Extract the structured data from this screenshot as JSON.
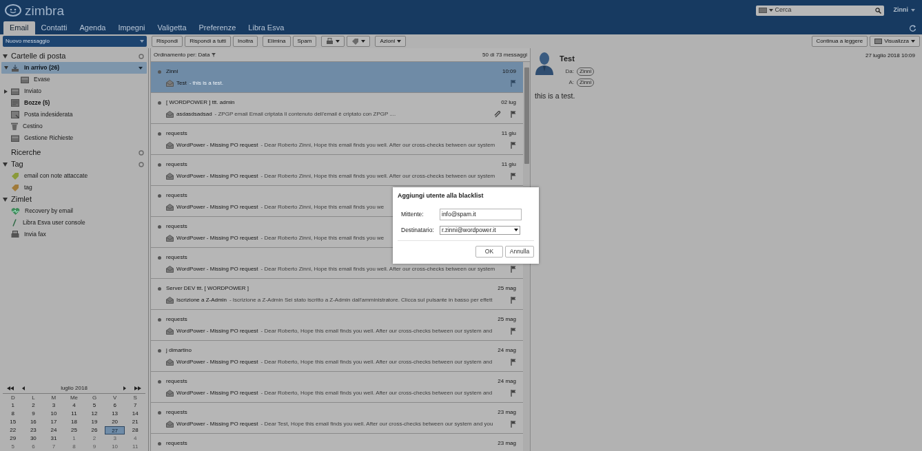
{
  "header": {
    "logo": "zimbra",
    "search": {
      "placeholder": "Cerca"
    },
    "user": "Zinni"
  },
  "tabs": [
    {
      "label": "Email",
      "selected": true
    },
    {
      "label": "Contatti",
      "selected": false
    },
    {
      "label": "Agenda",
      "selected": false
    },
    {
      "label": "Impegni",
      "selected": false
    },
    {
      "label": "Valigetta",
      "selected": false
    },
    {
      "label": "Preferenze",
      "selected": false
    },
    {
      "label": "Libra Esva",
      "selected": false
    }
  ],
  "new_button": "Nuovo messaggio",
  "toolbar": [
    {
      "kind": "text",
      "label": "Rispondi"
    },
    {
      "kind": "text",
      "label": "Rispondi a tutti"
    },
    {
      "kind": "text",
      "label": "Inoltra"
    },
    {
      "kind": "text",
      "label": "Elimina"
    },
    {
      "kind": "text",
      "label": "Spam"
    },
    {
      "kind": "print"
    },
    {
      "kind": "tag"
    },
    {
      "kind": "menu",
      "label": "Azioni"
    }
  ],
  "reading_toolbar": [
    {
      "kind": "text",
      "label": "Continua a leggere"
    },
    {
      "kind": "view",
      "label": "Visualizza"
    }
  ],
  "sidebar": {
    "sections": [
      {
        "title": "Cartelle di posta",
        "expanded": true,
        "gear": true,
        "items": [
          {
            "kind": "inbox",
            "label": "In arrivo (26)",
            "bold": true,
            "selected": true,
            "expanded": true,
            "children": [
              {
                "kind": "folder",
                "label": "Evase",
                "bold": false,
                "selected": false
              }
            ]
          },
          {
            "kind": "sent",
            "label": "Inviato",
            "bold": false,
            "selected": false,
            "expanded": false
          },
          {
            "kind": "drafts",
            "label": "Bozze (5)",
            "bold": true,
            "selected": false
          },
          {
            "kind": "junk",
            "label": "Posta indesiderata",
            "bold": false,
            "selected": false
          },
          {
            "kind": "trash",
            "label": "Cestino",
            "bold": false,
            "selected": false
          },
          {
            "kind": "folder",
            "label": "Gestione Richieste",
            "bold": false,
            "selected": false
          }
        ]
      },
      {
        "title": "Ricerche",
        "gear": true
      },
      {
        "title": "Tag",
        "expanded": true,
        "gear": true,
        "items": [
          {
            "kind": "tag",
            "label": "email con note attaccate",
            "bold": false,
            "selected": false,
            "color": "#8a9a3a"
          },
          {
            "kind": "tag",
            "label": "tag",
            "bold": false,
            "selected": false,
            "color": "#a07a3a"
          }
        ]
      },
      {
        "title": "Zimlet",
        "expanded": true,
        "gear": false,
        "items": [
          {
            "kind": "heart",
            "label": "Recovery by email",
            "bold": false,
            "selected": false
          },
          {
            "kind": "slash",
            "label": "Libra Esva user console",
            "bold": false,
            "selected": false
          },
          {
            "kind": "fax",
            "label": "Invia fax",
            "bold": false,
            "selected": false
          }
        ]
      }
    ]
  },
  "calendar": {
    "title": "luglio 2018",
    "weekdays": [
      "D",
      "L",
      "M",
      "Me",
      "G",
      "V",
      "S"
    ],
    "days": [
      {
        "label": "1",
        "muted": false,
        "selected": false
      },
      {
        "label": "2",
        "muted": false,
        "selected": false
      },
      {
        "label": "3",
        "muted": false,
        "selected": false
      },
      {
        "label": "4",
        "muted": false,
        "selected": false
      },
      {
        "label": "5",
        "muted": false,
        "selected": false
      },
      {
        "label": "6",
        "muted": false,
        "selected": false
      },
      {
        "label": "7",
        "muted": false,
        "selected": false
      },
      {
        "label": "8",
        "muted": false,
        "selected": false
      },
      {
        "label": "9",
        "muted": false,
        "selected": false
      },
      {
        "label": "10",
        "muted": false,
        "selected": false
      },
      {
        "label": "11",
        "muted": false,
        "selected": false
      },
      {
        "label": "12",
        "muted": false,
        "selected": false
      },
      {
        "label": "13",
        "muted": false,
        "selected": false
      },
      {
        "label": "14",
        "muted": false,
        "selected": false
      },
      {
        "label": "15",
        "muted": false,
        "selected": false
      },
      {
        "label": "16",
        "muted": false,
        "selected": false
      },
      {
        "label": "17",
        "muted": false,
        "selected": false
      },
      {
        "label": "18",
        "muted": false,
        "selected": false
      },
      {
        "label": "19",
        "muted": false,
        "selected": false
      },
      {
        "label": "20",
        "muted": false,
        "selected": false
      },
      {
        "label": "21",
        "muted": false,
        "selected": false
      },
      {
        "label": "22",
        "muted": false,
        "selected": false
      },
      {
        "label": "23",
        "muted": false,
        "selected": false
      },
      {
        "label": "24",
        "muted": false,
        "selected": false
      },
      {
        "label": "25",
        "muted": false,
        "selected": false
      },
      {
        "label": "26",
        "muted": false,
        "selected": false
      },
      {
        "label": "27",
        "muted": false,
        "selected": true
      },
      {
        "label": "28",
        "muted": false,
        "selected": false
      },
      {
        "label": "29",
        "muted": false,
        "selected": false
      },
      {
        "label": "30",
        "muted": false,
        "selected": false
      },
      {
        "label": "31",
        "muted": false,
        "selected": false
      },
      {
        "label": "1",
        "muted": true,
        "selected": false
      },
      {
        "label": "2",
        "muted": true,
        "selected": false
      },
      {
        "label": "3",
        "muted": true,
        "selected": false
      },
      {
        "label": "4",
        "muted": true,
        "selected": false
      },
      {
        "label": "5",
        "muted": true,
        "selected": false
      },
      {
        "label": "6",
        "muted": true,
        "selected": false
      },
      {
        "label": "7",
        "muted": true,
        "selected": false
      },
      {
        "label": "8",
        "muted": true,
        "selected": false
      },
      {
        "label": "9",
        "muted": true,
        "selected": false
      },
      {
        "label": "10",
        "muted": true,
        "selected": false
      },
      {
        "label": "11",
        "muted": true,
        "selected": false
      }
    ]
  },
  "list": {
    "sort": "Ordinamento per: Data",
    "count": "50 di 73 messaggi",
    "messages": [
      {
        "sender": "Zinni",
        "date": "10:09",
        "subject": "Test",
        "preview": "- this is a test.",
        "selected": true,
        "attachment": false,
        "flag": true
      },
      {
        "sender": "[ WORDPOWER ] ttt. admin",
        "date": "02 lug",
        "subject": "asdasdsadsad",
        "preview": "- ZPGP email Email criptata Il contenuto dell'email è criptato con ZPGP ....",
        "selected": false,
        "attachment": true,
        "flag": true
      },
      {
        "sender": "requests",
        "date": "11 giu",
        "subject": "WordPower - Missing PO request",
        "preview": "- Dear Roberto Zinni, Hope this email finds you well. After our cross-checks between our system",
        "selected": false,
        "attachment": false,
        "flag": true
      },
      {
        "sender": "requests",
        "date": "11 giu",
        "subject": "WordPower - Missing PO request",
        "preview": "- Dear Roberto Zinni, Hope this email finds you well. After our cross-checks between our system",
        "selected": false,
        "attachment": false,
        "flag": true
      },
      {
        "sender": "requests",
        "subject": "WordPower - Missing PO request",
        "preview": "- Dear Roberto Zinni, Hope this email finds you we",
        "selected": false,
        "attachment": false,
        "flag": false
      },
      {
        "sender": "requests",
        "subject": "WordPower - Missing PO request",
        "preview": "- Dear Roberto Zinni, Hope this email finds you we",
        "selected": false,
        "attachment": false,
        "flag": false
      },
      {
        "sender": "requests",
        "subject": "WordPower - Missing PO request",
        "preview": "- Dear Roberto Zinni, Hope this email finds you well. After our cross-checks between our system",
        "selected": false,
        "attachment": false,
        "flag": true
      },
      {
        "sender": "Server DEV ttt. [ WORDPOWER ]",
        "date": "25 mag",
        "subject": "Iscrizione a Z-Admin",
        "preview": "- Iscrizione a Z-Admin Sei stato iscritto a Z-Admin dall'amministratore. Clicca sul pulsante in basso per effett",
        "selected": false,
        "attachment": false,
        "flag": true
      },
      {
        "sender": "requests",
        "date": "25 mag",
        "subject": "WordPower - Missing PO request",
        "preview": "- Dear Roberto, Hope this email finds you well. After our cross-checks between our system and",
        "selected": false,
        "attachment": false,
        "flag": true
      },
      {
        "sender": "j dimartino",
        "date": "24 mag",
        "subject": "WordPower - Missing PO request",
        "preview": "- Dear Roberto, Hope this email finds you well. After our cross-checks between our system and",
        "selected": false,
        "attachment": false,
        "flag": true
      },
      {
        "sender": "requests",
        "date": "24 mag",
        "subject": "WordPower - Missing PO request",
        "preview": "- Dear Roberto, Hope this email finds you well. After our cross-checks between our system and",
        "selected": false,
        "attachment": false,
        "flag": true
      },
      {
        "sender": "requests",
        "date": "23 mag",
        "subject": "WordPower - Missing PO request",
        "preview": "- Dear Test, Hope this email finds you well. After our cross-checks between our system and you",
        "selected": false,
        "attachment": false,
        "flag": true
      },
      {
        "sender": "requests",
        "date": "23 mag",
        "selected": false
      }
    ]
  },
  "reading": {
    "subject": "Test",
    "date": "27 luglio 2018 10:09",
    "from_label": "Da:",
    "from": "Zinni",
    "to_label": "A:",
    "to": "Zinni",
    "body": "this is a test."
  },
  "dialog": {
    "title": "Aggiungi utente alla blacklist",
    "sender_label": "Mittente:",
    "sender_value": "info@spam.it",
    "recipient_label": "Destinatario:",
    "recipient_value": "r.zinni@wordpower.it",
    "ok": "OK",
    "cancel": "Annulla"
  }
}
